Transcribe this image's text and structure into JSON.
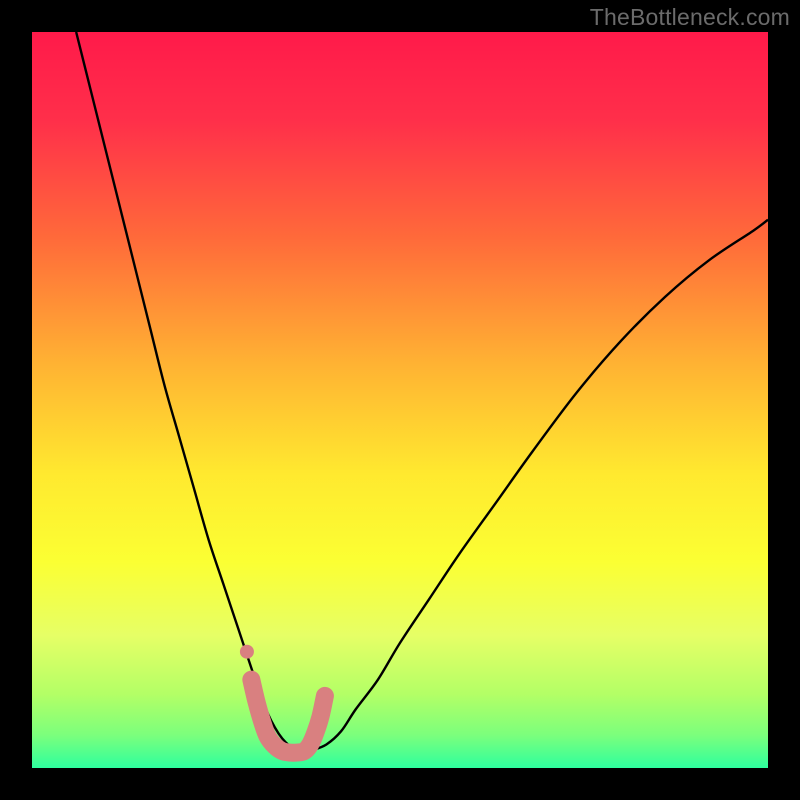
{
  "watermark": "TheBottleneck.com",
  "chart_data": {
    "type": "line",
    "title": "",
    "xlabel": "",
    "ylabel": "",
    "xlim": [
      0,
      100
    ],
    "ylim": [
      0,
      100
    ],
    "background_gradient": {
      "stops": [
        {
          "offset": 0.0,
          "color": "#ff1a4a"
        },
        {
          "offset": 0.12,
          "color": "#ff2f4a"
        },
        {
          "offset": 0.28,
          "color": "#ff6a3a"
        },
        {
          "offset": 0.45,
          "color": "#ffb233"
        },
        {
          "offset": 0.6,
          "color": "#ffe92f"
        },
        {
          "offset": 0.72,
          "color": "#fbff33"
        },
        {
          "offset": 0.82,
          "color": "#e6ff66"
        },
        {
          "offset": 0.9,
          "color": "#b3ff66"
        },
        {
          "offset": 0.955,
          "color": "#7cff7c"
        },
        {
          "offset": 1.0,
          "color": "#2eff9e"
        }
      ]
    },
    "series": [
      {
        "name": "bottleneck-curve",
        "color": "#000000",
        "x": [
          6,
          8,
          10,
          12,
          14,
          16,
          18,
          20,
          22,
          24,
          26,
          28,
          30,
          31,
          32,
          33,
          34,
          35,
          36,
          37,
          38,
          40,
          42,
          44,
          47,
          50,
          54,
          58,
          63,
          68,
          74,
          80,
          86,
          92,
          98,
          100
        ],
        "values": [
          100,
          92,
          84,
          76,
          68,
          60,
          52,
          45,
          38,
          31,
          25,
          19,
          13,
          10,
          7.5,
          5.5,
          4,
          3,
          2.4,
          2.2,
          2.4,
          3.2,
          5,
          8,
          12,
          17,
          23,
          29,
          36,
          43,
          51,
          58,
          64,
          69,
          73,
          74.5
        ]
      }
    ],
    "marker_band": {
      "name": "optimal-band",
      "color": "#d98080",
      "x": [
        29.8,
        30.5,
        31.3,
        32.0,
        33.0,
        34.0,
        35.0,
        36.0,
        37.0,
        37.8,
        38.5,
        39.2,
        39.8
      ],
      "values": [
        12.0,
        9.0,
        6.2,
        4.3,
        3.0,
        2.3,
        2.1,
        2.1,
        2.3,
        3.2,
        4.8,
        7.0,
        9.8
      ]
    },
    "lone_marker": {
      "name": "lone-marker",
      "color": "#d98080",
      "x": 29.2,
      "value": 15.8
    }
  }
}
